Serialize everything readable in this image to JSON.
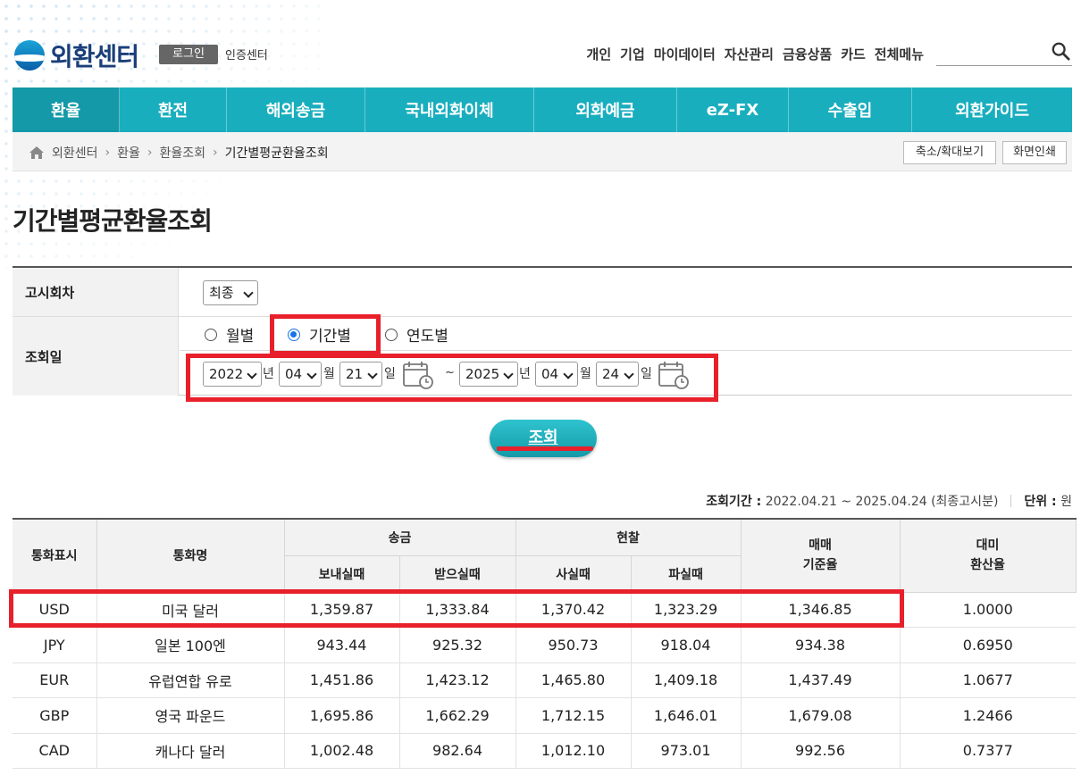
{
  "header": {
    "logo_text": "외환센터",
    "login_label": "로그인",
    "cert_center": "인증센터",
    "top_menu": [
      "개인",
      "기업",
      "마이데이터",
      "자산관리",
      "금융상품",
      "카드",
      "전체메뉴"
    ]
  },
  "nav": {
    "items": [
      "환율",
      "환전",
      "해외송금",
      "국내외화이체",
      "외화예금",
      "eZ-FX",
      "수출입",
      "외환가이드"
    ],
    "active": "환율"
  },
  "breadcrumb": [
    "외환센터",
    "환율",
    "환율조회",
    "기간별평균환율조회"
  ],
  "utility": {
    "zoom": "축소/확대보기",
    "print": "화면인쇄"
  },
  "page_title": "기간별평균환율조회",
  "form": {
    "notice_label": "고시회차",
    "notice_value": "최종",
    "date_label": "조회일",
    "radio_monthly": "월별",
    "radio_period": "기간별",
    "radio_yearly": "연도별",
    "selected_radio": "기간별",
    "start_year": "2022",
    "start_month": "04",
    "start_day": "21",
    "end_year": "2025",
    "end_month": "04",
    "end_day": "24",
    "unit_year": "년",
    "unit_month": "월",
    "unit_day": "일",
    "tilde": "~"
  },
  "search_button": "조회",
  "period_info": {
    "label": "조회기간 :",
    "value": "2022.04.21 ~ 2025.04.24 (최종고시분)",
    "unit_label": "단위 :",
    "unit_value": "원"
  },
  "table": {
    "headers": {
      "code": "통화표시",
      "name": "통화명",
      "wire": "송금",
      "cash": "현찰",
      "wire_send": "보내실때",
      "wire_receive": "받으실때",
      "cash_buy": "사실때",
      "cash_sell": "파실때",
      "base_rate": "매매\n기준율",
      "usd_rate": "대미\n환산율"
    },
    "rows": [
      {
        "code": "USD",
        "name": "미국 달러",
        "send": "1,359.87",
        "receive": "1,333.84",
        "buy": "1,370.42",
        "sell": "1,323.29",
        "base": "1,346.85",
        "usd": "1.0000"
      },
      {
        "code": "JPY",
        "name": "일본 100엔",
        "send": "943.44",
        "receive": "925.32",
        "buy": "950.73",
        "sell": "918.04",
        "base": "934.38",
        "usd": "0.6950"
      },
      {
        "code": "EUR",
        "name": "유럽연합 유로",
        "send": "1,451.86",
        "receive": "1,423.12",
        "buy": "1,465.80",
        "sell": "1,409.18",
        "base": "1,437.49",
        "usd": "1.0677"
      },
      {
        "code": "GBP",
        "name": "영국 파운드",
        "send": "1,695.86",
        "receive": "1,662.29",
        "buy": "1,712.15",
        "sell": "1,646.01",
        "base": "1,679.08",
        "usd": "1.2466"
      },
      {
        "code": "CAD",
        "name": "캐나다 달러",
        "send": "1,002.48",
        "receive": "982.64",
        "buy": "1,012.10",
        "sell": "973.01",
        "base": "992.56",
        "usd": "0.7377"
      }
    ]
  },
  "colors": {
    "nav": "#19aebe",
    "highlight": "#e8202b",
    "button": "#149aa8"
  }
}
